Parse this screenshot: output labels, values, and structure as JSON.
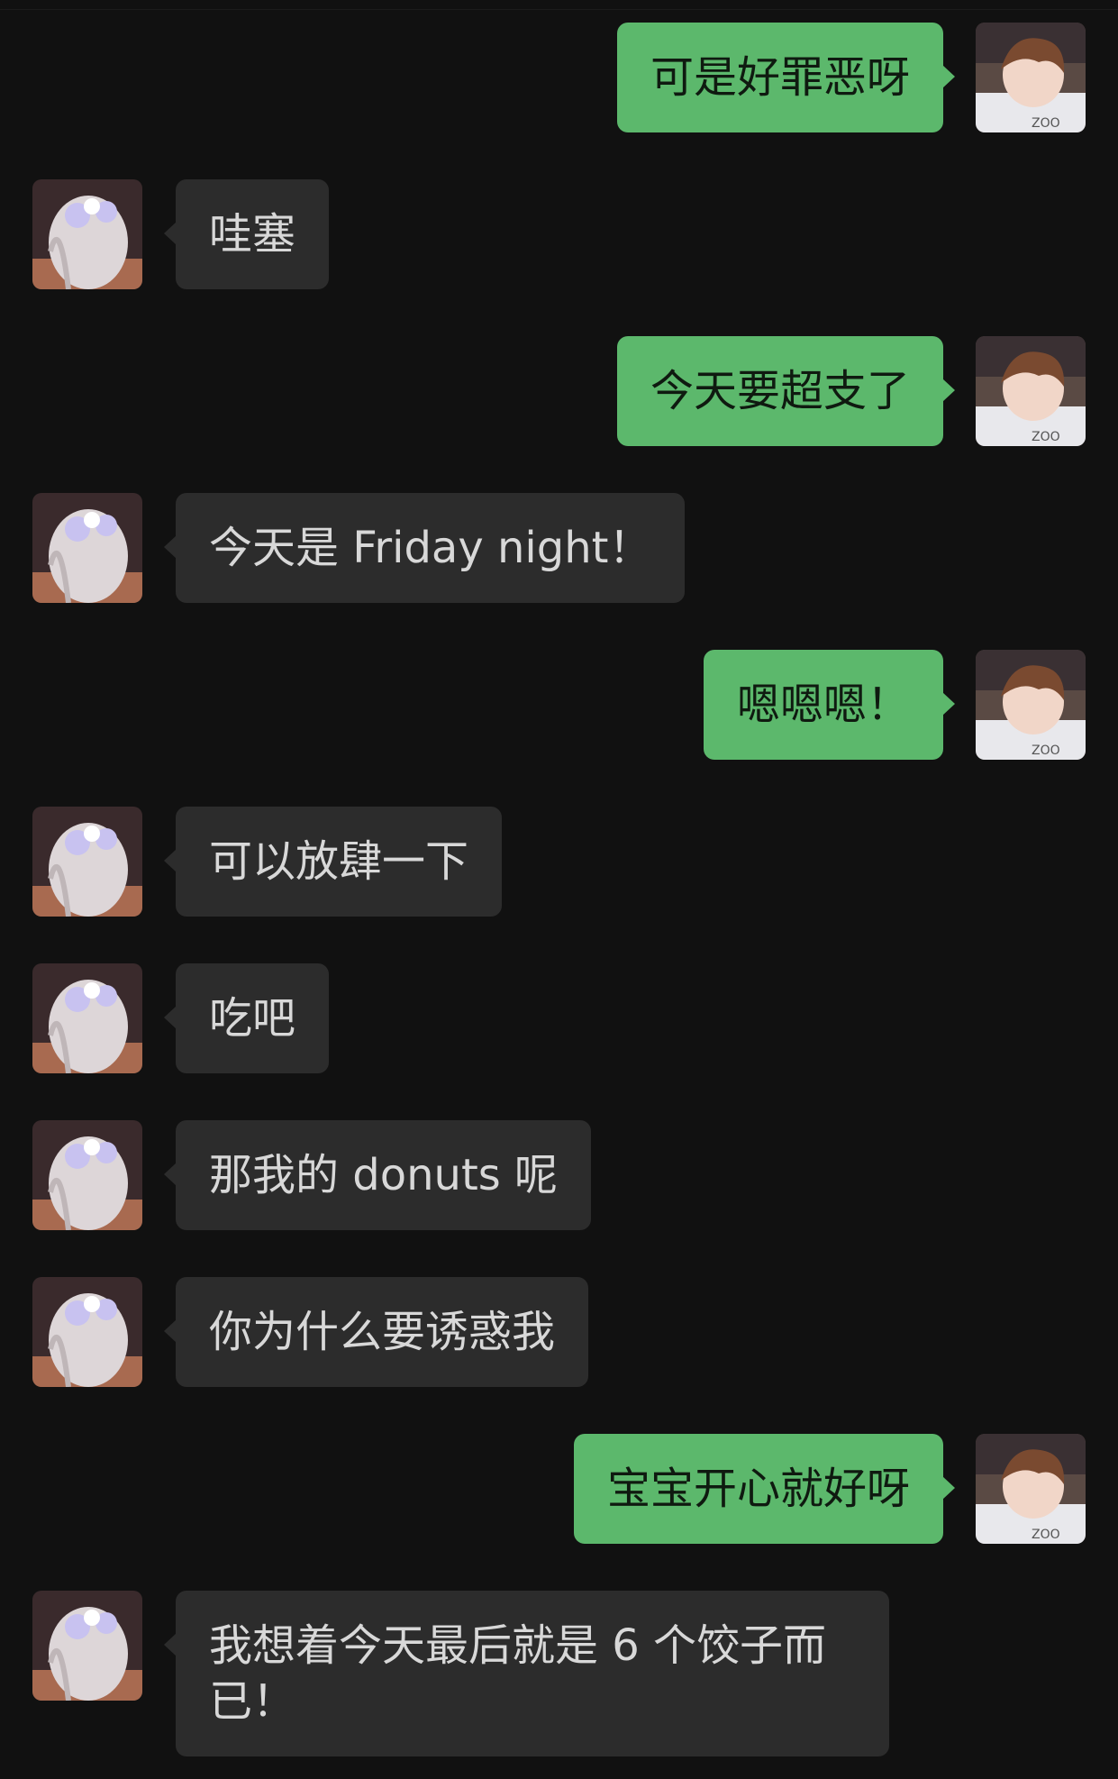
{
  "chat": {
    "messages": [
      {
        "side": "out",
        "text": "可是好罪恶呀"
      },
      {
        "side": "in",
        "text": "哇塞"
      },
      {
        "side": "out",
        "text": "今天要超支了"
      },
      {
        "side": "in",
        "text": "今天是 Friday night！"
      },
      {
        "side": "out",
        "text": "嗯嗯嗯！"
      },
      {
        "side": "in",
        "text": "可以放肆一下"
      },
      {
        "side": "in",
        "text": "吃吧"
      },
      {
        "side": "in",
        "text": "那我的 donuts 呢"
      },
      {
        "side": "in",
        "text": "你为什么要诱惑我"
      },
      {
        "side": "out",
        "text": "宝宝开心就好呀"
      },
      {
        "side": "in",
        "text": "我想着今天最后就是 6 个饺子而已！"
      }
    ]
  },
  "colors": {
    "background": "#111111",
    "incoming_bubble": "#2c2c2c",
    "outgoing_bubble": "#5cb86c"
  }
}
